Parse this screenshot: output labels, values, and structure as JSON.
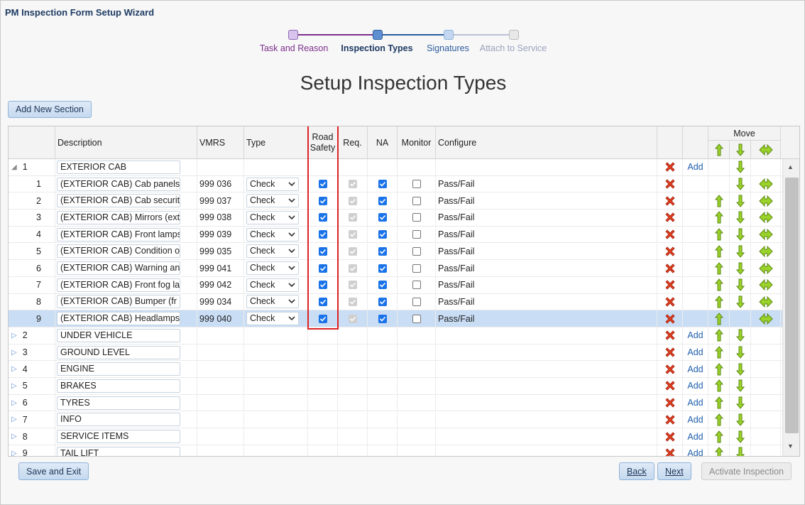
{
  "window": {
    "title": "PM Inspection Form Setup Wizard"
  },
  "wizard": {
    "steps": [
      {
        "label": "Task and Reason"
      },
      {
        "label": "Inspection Types"
      },
      {
        "label": "Signatures"
      },
      {
        "label": "Attach to Service"
      }
    ]
  },
  "page": {
    "heading": "Setup Inspection Types"
  },
  "toolbar": {
    "add_section": "Add New Section"
  },
  "grid": {
    "columns": {
      "description": "Description",
      "vmrs": "VMRS",
      "type": "Type",
      "road_safety": "Road Safety",
      "req": "Req.",
      "na": "NA",
      "monitor": "Monitor",
      "configure": "Configure",
      "move": "Move"
    },
    "add_label": "Add",
    "section1": {
      "num": "1",
      "description": "EXTERIOR CAB"
    },
    "items": [
      {
        "num": "1",
        "description": "(EXTERIOR CAB) Cab panels",
        "vmrs": "999 036",
        "type": "Check",
        "configure": "Pass/Fail"
      },
      {
        "num": "2",
        "description": "(EXTERIOR CAB) Cab security",
        "vmrs": "999 037",
        "type": "Check",
        "configure": "Pass/Fail"
      },
      {
        "num": "3",
        "description": "(EXTERIOR CAB) Mirrors (ext",
        "vmrs": "999 038",
        "type": "Check",
        "configure": "Pass/Fail"
      },
      {
        "num": "4",
        "description": "(EXTERIOR CAB) Front lamps",
        "vmrs": "999 039",
        "type": "Check",
        "configure": "Pass/Fail"
      },
      {
        "num": "5",
        "description": "(EXTERIOR CAB) Condition of",
        "vmrs": "999 035",
        "type": "Check",
        "configure": "Pass/Fail"
      },
      {
        "num": "6",
        "description": "(EXTERIOR CAB) Warning and",
        "vmrs": "999 041",
        "type": "Check",
        "configure": "Pass/Fail"
      },
      {
        "num": "7",
        "description": "(EXTERIOR CAB) Front fog la",
        "vmrs": "999 042",
        "type": "Check",
        "configure": "Pass/Fail"
      },
      {
        "num": "8",
        "description": "(EXTERIOR CAB) Bumper (fr",
        "vmrs": "999 034",
        "type": "Check",
        "configure": "Pass/Fail"
      },
      {
        "num": "9",
        "description": "(EXTERIOR CAB) Headlamps",
        "vmrs": "999 040",
        "type": "Check",
        "configure": "Pass/Fail"
      }
    ],
    "sections": [
      {
        "num": "2",
        "description": "UNDER VEHICLE"
      },
      {
        "num": "3",
        "description": "GROUND LEVEL"
      },
      {
        "num": "4",
        "description": "ENGINE"
      },
      {
        "num": "5",
        "description": "BRAKES"
      },
      {
        "num": "6",
        "description": "TYRES"
      },
      {
        "num": "7",
        "description": "INFO"
      },
      {
        "num": "8",
        "description": "SERVICE ITEMS"
      },
      {
        "num": "9",
        "description": "TAIL LIFT"
      }
    ]
  },
  "footer": {
    "save_exit": "Save and Exit",
    "back": "Back",
    "next": "Next",
    "activate": "Activate Inspection"
  }
}
